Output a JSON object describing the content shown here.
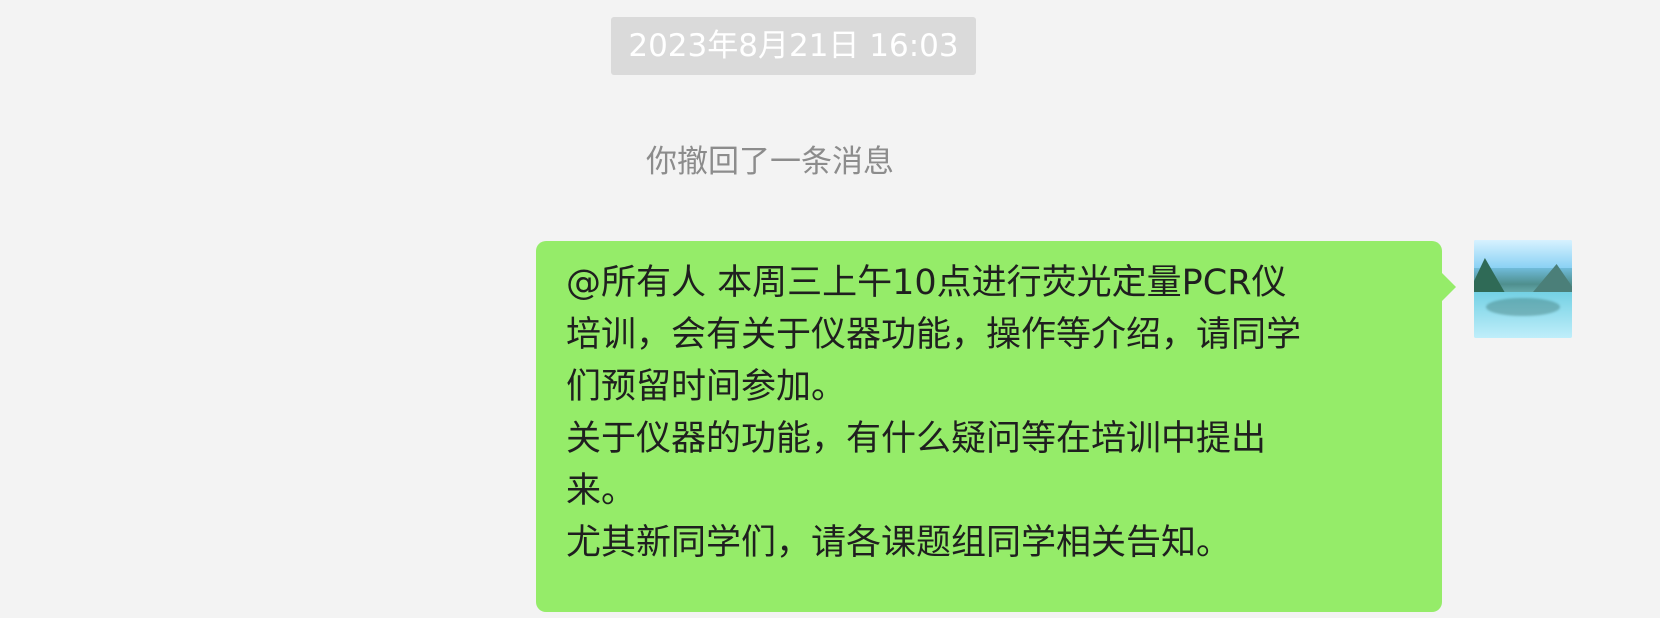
{
  "chat": {
    "timestamp": "2023年8月21日 16:03",
    "system_notice": "你撤回了一条消息",
    "message": {
      "text": "@所有人 本周三上午10点进行荧光定量PCR仪\n培训，会有关于仪器功能，操作等介绍，请同学\n们预留时间参加。\n关于仪器的功能，有什么疑问等在培训中提出\n来。\n尤其新同学们，请各课题组同学相关告知。"
    }
  },
  "colors": {
    "background": "#f3f3f3",
    "timestamp_background": "#dadada",
    "message_bubble": "#95ec69",
    "system_text": "#8c8c8c",
    "message_text": "#1f1f1f"
  }
}
